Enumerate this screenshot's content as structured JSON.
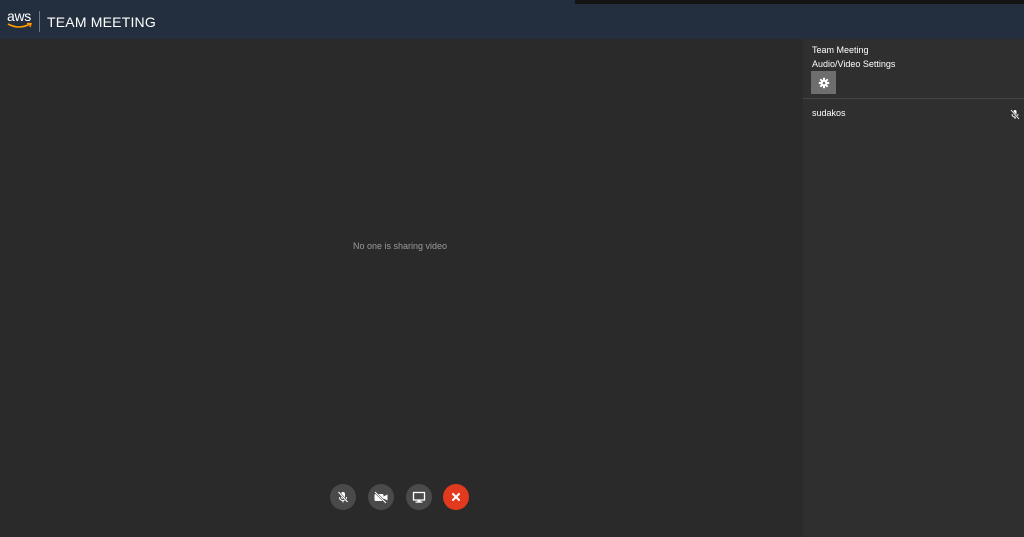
{
  "header": {
    "logo_text": "aws",
    "title": "TEAM MEETING"
  },
  "main": {
    "empty_message": "No one is sharing video"
  },
  "controls": [
    {
      "name": "mute-microphone-button",
      "icon": "mic-muted-icon"
    },
    {
      "name": "toggle-video-button",
      "icon": "video-off-icon"
    },
    {
      "name": "share-screen-button",
      "icon": "monitor-icon"
    },
    {
      "name": "end-meeting-button",
      "icon": "close-icon"
    }
  ],
  "sidebar": {
    "meeting_title": "Team Meeting",
    "settings_label": "Audio/Video Settings",
    "settings_icon": "gear-icon",
    "attendees": [
      {
        "name": "sudakos",
        "mic_icon": "mic-muted-icon"
      }
    ]
  },
  "colors": {
    "header_bg": "#232f3e",
    "stage_bg": "#2a2a2a",
    "sidebar_bg": "#2f2f2f",
    "end_call": "#e13a1f",
    "aws_smile": "#ff9900"
  }
}
